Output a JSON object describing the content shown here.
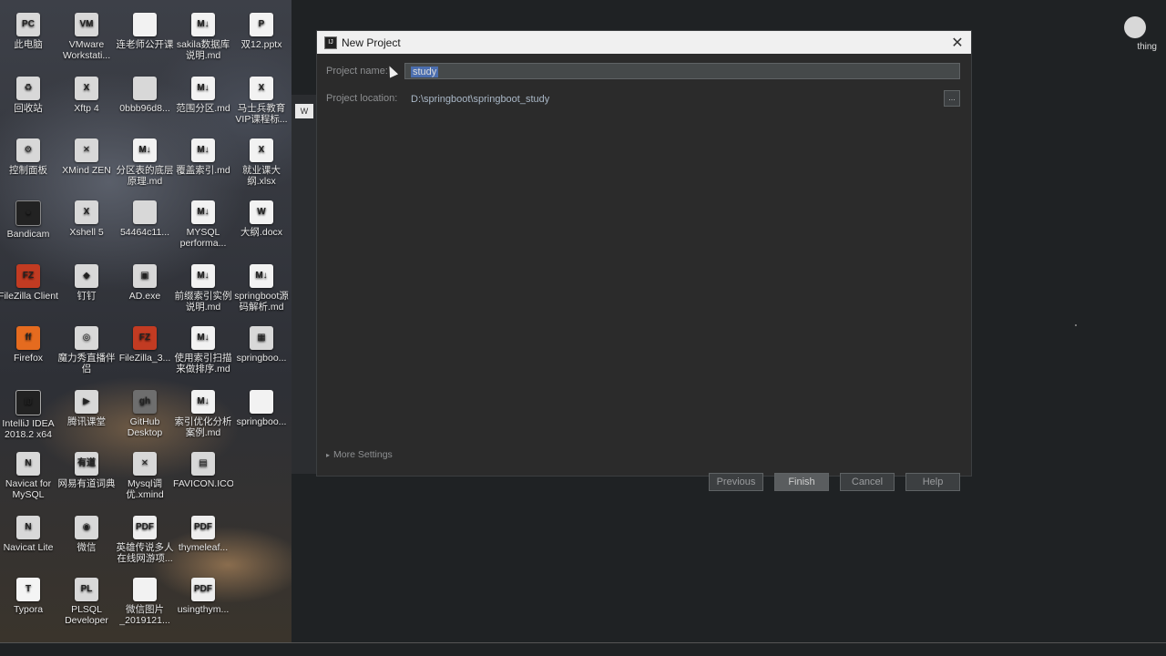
{
  "desktop": {
    "icons": [
      {
        "label": "此电脑",
        "glyph": "PC",
        "kind": "g-app"
      },
      {
        "label": "VMware Workstati...",
        "glyph": "VM",
        "kind": "g-app"
      },
      {
        "label": "连老师公开课",
        "glyph": "",
        "kind": "g-md"
      },
      {
        "label": "sakila数据库说明.md",
        "glyph": "M↓",
        "kind": "g-md"
      },
      {
        "label": "双12.pptx",
        "glyph": "P",
        "kind": "g-md"
      },
      {
        "label": "回收站",
        "glyph": "♻",
        "kind": "g-app"
      },
      {
        "label": "Xftp 4",
        "glyph": "X",
        "kind": "g-app"
      },
      {
        "label": "0bbb96d8...",
        "glyph": "",
        "kind": "g-app"
      },
      {
        "label": "范围分区.md",
        "glyph": "M↓",
        "kind": "g-md"
      },
      {
        "label": "马士兵教育VIP课程标...",
        "glyph": "X",
        "kind": "g-xls"
      },
      {
        "label": "控制面板",
        "glyph": "⚙",
        "kind": "g-app"
      },
      {
        "label": "XMind ZEN",
        "glyph": "✕",
        "kind": "g-app"
      },
      {
        "label": "分区表的底层原理.md",
        "glyph": "M↓",
        "kind": "g-md"
      },
      {
        "label": "覆盖索引.md",
        "glyph": "M↓",
        "kind": "g-md"
      },
      {
        "label": "就业课大纲.xlsx",
        "glyph": "X",
        "kind": "g-xls"
      },
      {
        "label": "Bandicam",
        "glyph": "●",
        "kind": "g-bc"
      },
      {
        "label": "Xshell 5",
        "glyph": "X",
        "kind": "g-app"
      },
      {
        "label": "54464c11...",
        "glyph": "",
        "kind": "g-app"
      },
      {
        "label": "MYSQL performa...",
        "glyph": "M↓",
        "kind": "g-md"
      },
      {
        "label": "大纲.docx",
        "glyph": "W",
        "kind": "g-doc"
      },
      {
        "label": "FileZilla Client",
        "glyph": "FZ",
        "kind": "g-fz"
      },
      {
        "label": "钉钉",
        "glyph": "◆",
        "kind": "g-app"
      },
      {
        "label": "AD.exe",
        "glyph": "▣",
        "kind": "g-app"
      },
      {
        "label": "前缀索引实例说明.md",
        "glyph": "M↓",
        "kind": "g-md"
      },
      {
        "label": "springboot源码解析.md",
        "glyph": "M↓",
        "kind": "g-md"
      },
      {
        "label": "Firefox",
        "glyph": "ff",
        "kind": "g-fox"
      },
      {
        "label": "魔力秀直播伴侣",
        "glyph": "◎",
        "kind": "g-app"
      },
      {
        "label": "FileZilla_3...",
        "glyph": "FZ",
        "kind": "g-fz"
      },
      {
        "label": "使用索引扫描来做排序.md",
        "glyph": "M↓",
        "kind": "g-md"
      },
      {
        "label": "springboo...",
        "glyph": "▦",
        "kind": "g-app"
      },
      {
        "label": "IntelliJ IDEA 2018.2 x64",
        "glyph": "IJ",
        "kind": "g-idea"
      },
      {
        "label": "腾讯课堂",
        "glyph": "▶",
        "kind": "g-app"
      },
      {
        "label": "GitHub Desktop",
        "glyph": "gh",
        "kind": "g-git"
      },
      {
        "label": "索引优化分析案例.md",
        "glyph": "M↓",
        "kind": "g-md"
      },
      {
        "label": "springboo...",
        "glyph": "",
        "kind": "g-md"
      },
      {
        "label": "Navicat for MySQL",
        "glyph": "N",
        "kind": "g-app"
      },
      {
        "label": "网易有道词典",
        "glyph": "有道",
        "kind": "g-app"
      },
      {
        "label": "Mysql调优.xmind",
        "glyph": "✕",
        "kind": "g-app"
      },
      {
        "label": "FAVICON.ICO",
        "glyph": "▤",
        "kind": "g-app"
      },
      {
        "label": "",
        "glyph": "",
        "kind": ""
      },
      {
        "label": "Navicat Lite",
        "glyph": "N",
        "kind": "g-app"
      },
      {
        "label": "微信",
        "glyph": "◉",
        "kind": "g-app"
      },
      {
        "label": "英雄传说多人在线网游项...",
        "glyph": "PDF",
        "kind": "g-pdf"
      },
      {
        "label": "thymeleaf...",
        "glyph": "PDF",
        "kind": "g-pdf"
      },
      {
        "label": "",
        "glyph": "",
        "kind": ""
      },
      {
        "label": "Typora",
        "glyph": "T",
        "kind": "g-ty"
      },
      {
        "label": "PLSQL Developer",
        "glyph": "PL",
        "kind": "g-app"
      },
      {
        "label": "微信图片_2019121...",
        "glyph": "",
        "kind": "g-md"
      },
      {
        "label": "usingthym...",
        "glyph": "PDF",
        "kind": "g-pdf"
      }
    ]
  },
  "dialog": {
    "title": "New Project",
    "project_name_label": "Project name:",
    "project_name_value": "study",
    "project_location_label": "Project location:",
    "project_location_value": "D:\\springboot\\springboot_study",
    "browse_label": "...",
    "more_settings_label": "More Settings",
    "buttons": {
      "previous": "Previous",
      "finish": "Finish",
      "cancel": "Cancel",
      "help": "Help"
    }
  },
  "corner": {
    "label": "thing"
  }
}
